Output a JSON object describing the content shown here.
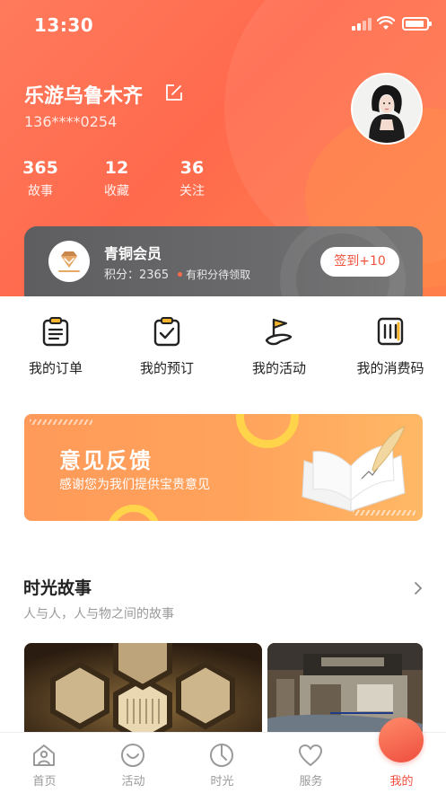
{
  "status_bar": {
    "time": "13:30"
  },
  "profile": {
    "name": "乐游乌鲁木齐",
    "phone": "136****0254",
    "stats": [
      {
        "value": "365",
        "label": "故事"
      },
      {
        "value": "12",
        "label": "收藏"
      },
      {
        "value": "36",
        "label": "关注"
      }
    ]
  },
  "membership": {
    "level": "青铜会员",
    "points_label": "积分：",
    "points_value": "2365",
    "points_tip": "有积分待领取",
    "checkin_label": "签到+10"
  },
  "quick_actions": [
    {
      "label": "我的订单",
      "icon": "order-clipboard-icon"
    },
    {
      "label": "我的预订",
      "icon": "reservation-check-icon"
    },
    {
      "label": "我的活动",
      "icon": "activity-flag-icon"
    },
    {
      "label": "我的消费码",
      "icon": "consumption-code-icon"
    }
  ],
  "feedback_banner": {
    "title": "意见反馈",
    "subtitle": "感谢您为我们提供宝贵意见"
  },
  "stories_section": {
    "title": "时光故事",
    "subtitle": "人与人，人与物之间的故事"
  },
  "tab_bar": {
    "tabs": [
      {
        "label": "首页",
        "icon": "home-icon"
      },
      {
        "label": "活动",
        "icon": "smile-icon"
      },
      {
        "label": "时光",
        "icon": "clock-icon"
      },
      {
        "label": "服务",
        "icon": "heart-icon"
      },
      {
        "label": "我的",
        "icon": "user-icon"
      }
    ],
    "active_index": 4
  },
  "colors": {
    "brand": "#ff6a4d",
    "accent": "#ee4f3e",
    "feedback_orange": "#ffa35b",
    "ring_yellow": "#ffd44a",
    "member_gray": "#666668"
  }
}
